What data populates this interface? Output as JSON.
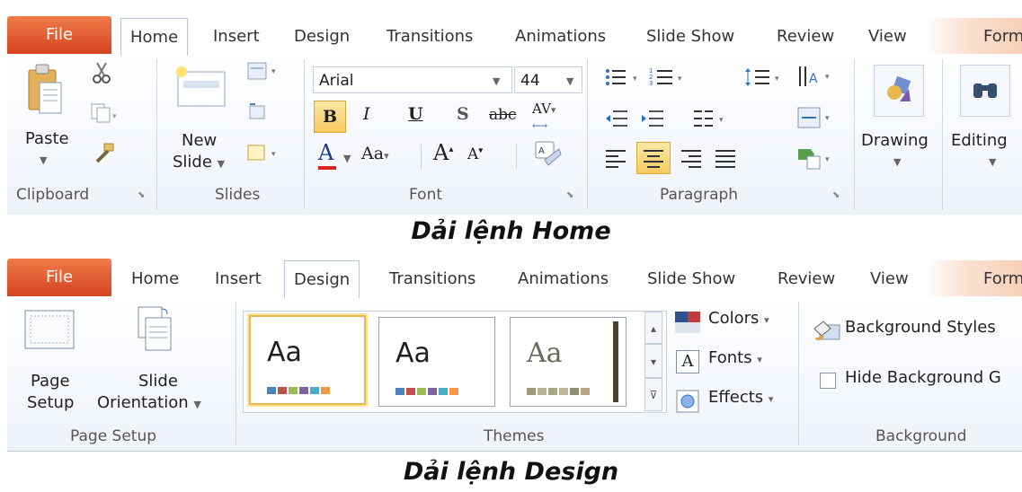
{
  "ribbon_home": {
    "tabs": [
      "File",
      "Home",
      "Insert",
      "Design",
      "Transitions",
      "Animations",
      "Slide Show",
      "Review",
      "View",
      "Form"
    ],
    "active_tab": "Home",
    "clipboard": {
      "paste": "Paste",
      "group": "Clipboard"
    },
    "slides": {
      "new_slide_line1": "New",
      "new_slide_line2": "Slide",
      "group": "Slides"
    },
    "font": {
      "family": "Arial",
      "size": "44",
      "bold": "B",
      "italic": "I",
      "underline": "U",
      "shadow": "S",
      "strike": "abc",
      "spacing": "AV",
      "font_color": "A",
      "change_case": "Aa",
      "grow": "A",
      "shrink": "A",
      "group": "Font"
    },
    "paragraph": {
      "group": "Paragraph"
    },
    "drawing": {
      "label": "Drawing"
    },
    "editing": {
      "label": "Editing"
    }
  },
  "caption_home": "Dải lệnh Home",
  "ribbon_design": {
    "tabs": [
      "File",
      "Home",
      "Insert",
      "Design",
      "Transitions",
      "Animations",
      "Slide Show",
      "Review",
      "View",
      "Form"
    ],
    "active_tab": "Design",
    "page_setup": {
      "page_setup_line1": "Page",
      "page_setup_line2": "Setup",
      "orientation_line1": "Slide",
      "orientation_line2": "Orientation",
      "group": "Page Setup"
    },
    "themes": {
      "theme_text": [
        "Aa",
        "Aa",
        "Aa"
      ],
      "colors": "Colors",
      "fonts": "Fonts",
      "effects": "Effects",
      "group": "Themes"
    },
    "background": {
      "styles": "Background Styles",
      "hide": "Hide Background G",
      "group": "Background"
    }
  },
  "caption_design": "Dải lệnh Design",
  "colors": {
    "file_tab": "#d5451f",
    "highlight": "#f7c95e",
    "accent_blue": "#2b579a"
  }
}
